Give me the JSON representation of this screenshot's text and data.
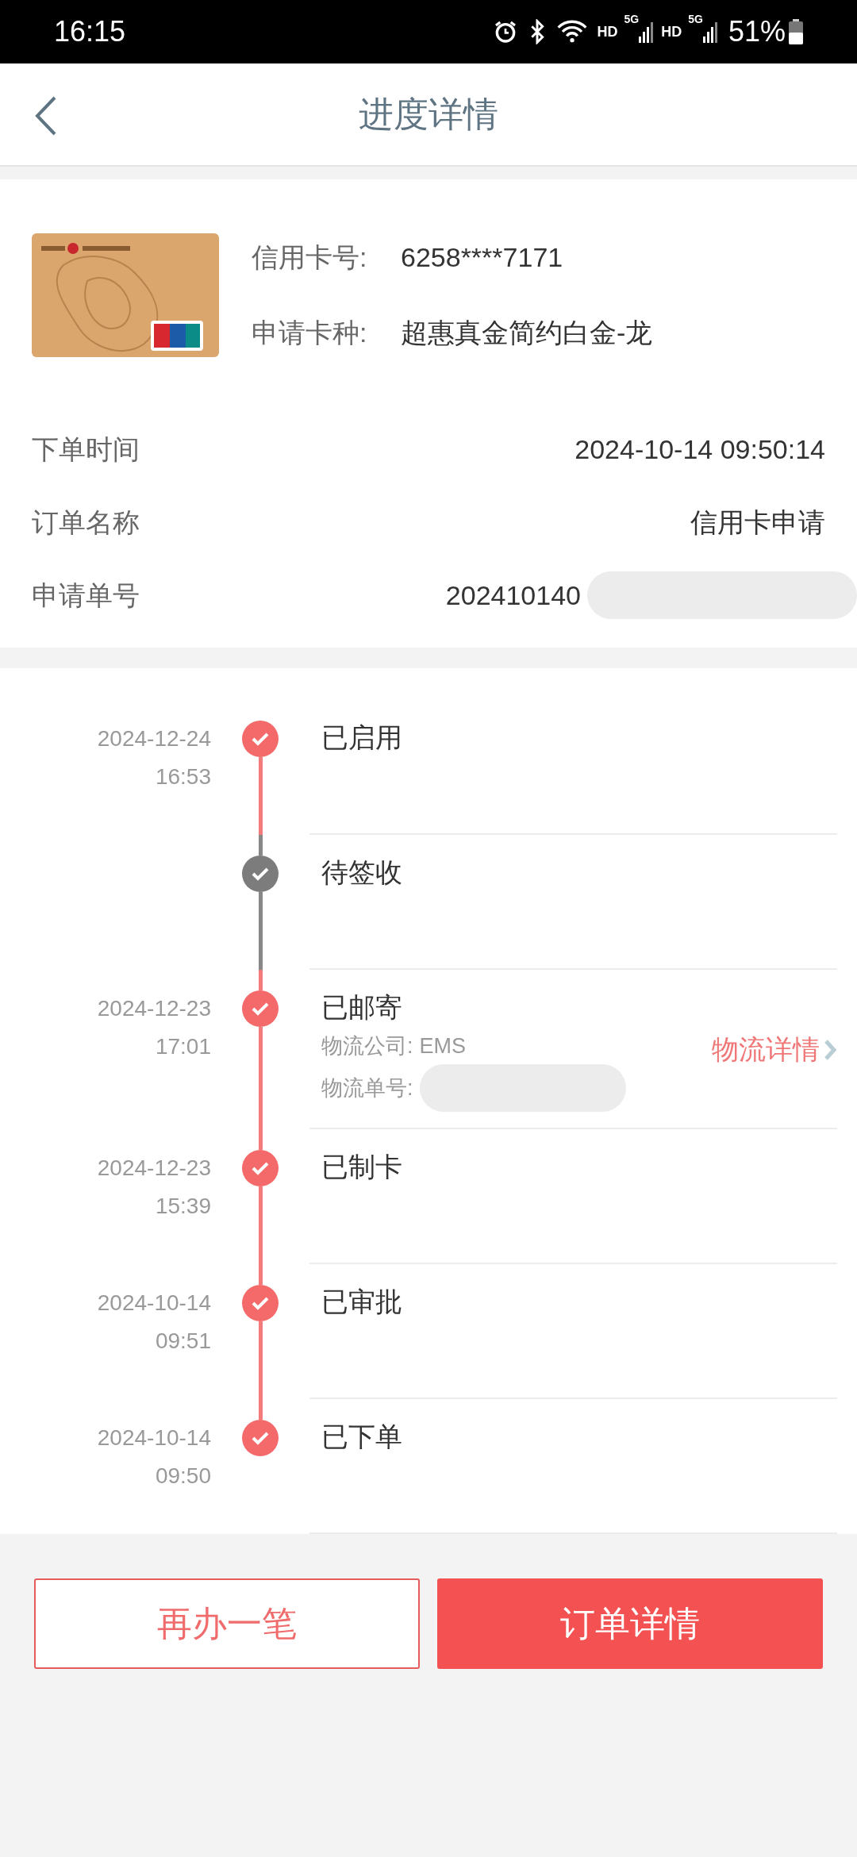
{
  "status_bar": {
    "time": "16:15",
    "network": [
      "HD",
      "5G",
      "HD",
      "5G"
    ],
    "battery": "51%"
  },
  "header": {
    "title": "进度详情"
  },
  "card": {
    "fields": [
      {
        "label": "信用卡号:",
        "value": "6258****7171"
      },
      {
        "label": "申请卡种:",
        "value": "超惠真金简约白金-龙"
      }
    ]
  },
  "order": {
    "rows": [
      {
        "label": "下单时间",
        "value": "2024-10-14 09:50:14"
      },
      {
        "label": "订单名称",
        "value": "信用卡申请"
      },
      {
        "label": "申请单号",
        "value": "202410140",
        "redacted": true
      }
    ]
  },
  "timeline": [
    {
      "date": "2024-12-24",
      "time": "16:53",
      "title": "已启用",
      "completed": true
    },
    {
      "title": "待签收",
      "completed": false
    },
    {
      "date": "2024-12-23",
      "time": "17:01",
      "title": "已邮寄",
      "completed": true,
      "details": [
        {
          "label": "物流公司:",
          "value": "EMS"
        },
        {
          "label": "物流单号:",
          "redacted": true
        }
      ],
      "link": "物流详情"
    },
    {
      "date": "2024-12-23",
      "time": "15:39",
      "title": "已制卡",
      "completed": true
    },
    {
      "date": "2024-10-14",
      "time": "09:51",
      "title": "已审批",
      "completed": true
    },
    {
      "date": "2024-10-14",
      "time": "09:50",
      "title": "已下单",
      "completed": true
    }
  ],
  "buttons": [
    {
      "label": "再办一笔",
      "kind": "outline"
    },
    {
      "label": "订单详情",
      "kind": "filled"
    }
  ]
}
